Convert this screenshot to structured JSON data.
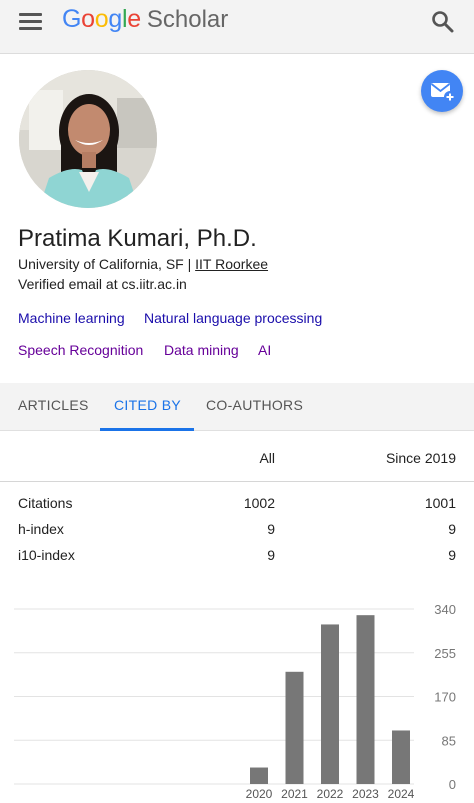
{
  "header": {
    "brand": "Google",
    "product": "Scholar",
    "brand_colors": [
      "#4285f4",
      "#ea4335",
      "#fbbc05",
      "#4285f4",
      "#34a853",
      "#ea4335"
    ]
  },
  "profile": {
    "name": "Pratima Kumari, Ph.D.",
    "affiliation_prefix": "University of California, SF | ",
    "affiliation_link": "IIT Roorkee",
    "email": "Verified email at cs.iitr.ac.in",
    "interests": [
      {
        "label": "Machine learning",
        "color": "#1a0dab"
      },
      {
        "label": "Natural language processing",
        "color": "#1a0dab"
      },
      {
        "label": "Speech Recognition",
        "color": "#660099"
      },
      {
        "label": "Data mining",
        "color": "#660099"
      },
      {
        "label": "AI",
        "color": "#660099"
      }
    ]
  },
  "tabs": [
    {
      "label": "ARTICLES",
      "active": false
    },
    {
      "label": "CITED BY",
      "active": true
    },
    {
      "label": "CO-AUTHORS",
      "active": false
    }
  ],
  "stats": {
    "col_all": "All",
    "col_since": "Since 2019",
    "rows": [
      {
        "label": "Citations",
        "all": "1002",
        "since": "1001"
      },
      {
        "label": "h-index",
        "all": "9",
        "since": "9"
      },
      {
        "label": "i10-index",
        "all": "9",
        "since": "9"
      }
    ]
  },
  "chart_data": {
    "type": "bar",
    "categories": [
      "2020",
      "2021",
      "2022",
      "2023",
      "2024"
    ],
    "values": [
      32,
      218,
      310,
      328,
      104
    ],
    "yticks": [
      0,
      85,
      170,
      255,
      340
    ],
    "ylim": [
      0,
      340
    ],
    "bar_color": "#777777",
    "grid": true,
    "title": "",
    "xlabel": "",
    "ylabel": ""
  }
}
